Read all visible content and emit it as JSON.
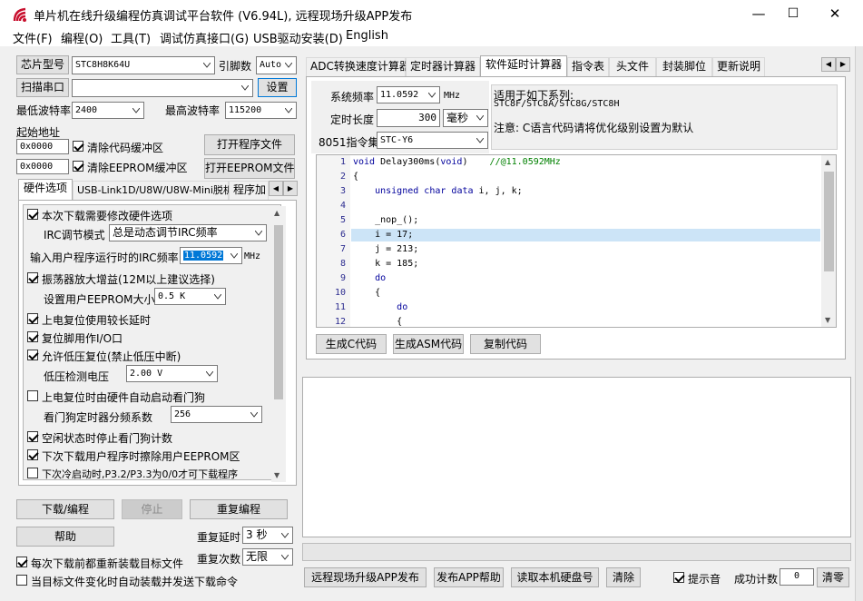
{
  "window": {
    "title": "单片机在线升级编程仿真调试平台软件 (V6.94L), 远程现场升级APP发布",
    "controls": {
      "minimize": "—",
      "maximize": "☐",
      "close": "✕"
    }
  },
  "menu": [
    {
      "label": "文件(F)"
    },
    {
      "label": "编程(O)"
    },
    {
      "label": "工具(T)"
    },
    {
      "label": "调试仿真接口(G)"
    },
    {
      "label": "USB驱动安装(D)"
    },
    {
      "label": "English"
    }
  ],
  "left": {
    "chip_type_button": "芯片型号",
    "chip_type_value": "STC8H8K64U",
    "pin_label": "引脚数",
    "pin_value": "Auto",
    "scan_port_button": "扫描串口",
    "port_value": "",
    "settings_button": "设置",
    "min_baud_label": "最低波特率",
    "min_baud_value": "2400",
    "max_baud_label": "最高波特率",
    "max_baud_value": "115200",
    "start_addr_label": "起始地址",
    "addr_code_value": "0x0000",
    "clear_code_label": "清除代码缓冲区",
    "addr_eeprom_value": "0x0000",
    "clear_eeprom_label": "清除EEPROM缓冲区",
    "open_program_button": "打开程序文件",
    "open_eeprom_button": "打开EEPROM文件",
    "tabs": [
      {
        "label": "硬件选项"
      },
      {
        "label": "USB-Link1D/U8W/U8W-Mini脱机"
      },
      {
        "label": "程序加"
      }
    ],
    "hw": {
      "need_modify": "本次下载需要修改硬件选项",
      "irc_mode_label": "IRC调节模式",
      "irc_mode_value": "总是动态调节IRC频率",
      "irc_freq_label": "输入用户程序运行时的IRC频率",
      "irc_freq_value": "11.0592",
      "irc_freq_unit": "MHz",
      "osc_gain": "振荡器放大增益(12M以上建议选择)",
      "eeprom_size_label": "设置用户EEPROM大小",
      "eeprom_size_value": "0.5 K",
      "long_delay": "上电复位使用较长延时",
      "reset_io": "复位脚用作I/O口",
      "lvr_enable": "允许低压复位(禁止低压中断)",
      "lvr_voltage_label": "低压检测电压",
      "lvr_voltage_value": "2.00 V",
      "wdt_auto": "上电复位时由硬件自动启动看门狗",
      "wdt_div_label": "看门狗定时器分频系数",
      "wdt_div_value": "256",
      "wdt_idle_stop": "空闲状态时停止看门狗计数",
      "erase_eeprom": "下次下载用户程序时擦除用户EEPROM区",
      "cold_boot": "下次冷启动时,P3.2/P3.3为0/0才可下载程序"
    },
    "download_button": "下载/编程",
    "stop_button": "停止",
    "reprogram_button": "重复编程",
    "help_button": "帮助",
    "repeat_delay_label": "重复延时",
    "repeat_delay_value": "3 秒",
    "repeat_count_label": "重复次数",
    "repeat_count_value": "无限",
    "reload_before": "每次下载前都重新装载目标文件",
    "auto_reload": "当目标文件变化时自动装载并发送下载命令"
  },
  "right": {
    "tabs": [
      {
        "label": "ADC转换速度计算器"
      },
      {
        "label": "定时器计算器"
      },
      {
        "label": "软件延时计算器"
      },
      {
        "label": "指令表"
      },
      {
        "label": "头文件"
      },
      {
        "label": "封装脚位"
      },
      {
        "label": "更新说明"
      }
    ],
    "sys_freq_label": "系统频率",
    "sys_freq_value": "11.0592",
    "sys_freq_unit": "MHz",
    "delay_len_label": "定时长度",
    "delay_len_value": "300",
    "delay_unit": "毫秒",
    "inst_set_label": "8051指令集",
    "inst_set_value": "STC-Y6",
    "applies_title": "适用于如下系列:",
    "applies_series": "STC8F/STC8A/STC8G/STC8H",
    "note": "注意: C语言代码请将优化级别设置为默认",
    "code_lines": [
      {
        "n": "1",
        "t": "void Delay300ms(void)\t//@11.0592MHz"
      },
      {
        "n": "2",
        "t": "{"
      },
      {
        "n": "3",
        "t": "\tunsigned char data i, j, k;"
      },
      {
        "n": "4",
        "t": ""
      },
      {
        "n": "5",
        "t": "\t_nop_();"
      },
      {
        "n": "6",
        "t": "\ti = 17;"
      },
      {
        "n": "7",
        "t": "\tj = 213;"
      },
      {
        "n": "8",
        "t": "\tk = 185;"
      },
      {
        "n": "9",
        "t": "\tdo"
      },
      {
        "n": "10",
        "t": "\t{"
      },
      {
        "n": "11",
        "t": "\t\tdo"
      },
      {
        "n": "12",
        "t": "\t\t{"
      }
    ],
    "gen_c_button": "生成C代码",
    "gen_asm_button": "生成ASM代码",
    "copy_button": "复制代码",
    "remote_upgrade_button": "远程现场升级APP发布",
    "publish_help_button": "发布APP帮助",
    "read_hdd_button": "读取本机硬盘号",
    "clear_button": "清除",
    "sound_label": "提示音",
    "success_label": "成功计数",
    "success_value": "0",
    "reset_count_button": "清零"
  }
}
